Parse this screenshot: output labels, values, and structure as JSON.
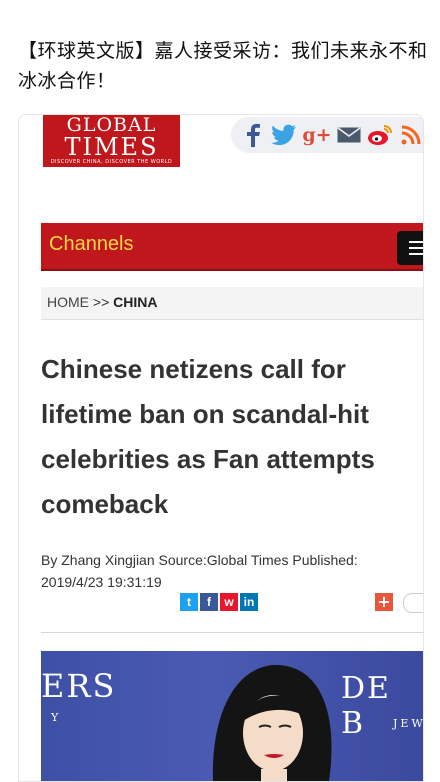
{
  "caption": "【环球英文版】嘉人接受采访：我们未来永不和冰冰合作！",
  "logo": {
    "line1": "GLOBAL",
    "line2": "TIMES",
    "tagline": "DISCOVER CHINA, DISCOVER THE WORLD"
  },
  "social_icons": [
    "facebook-icon",
    "twitter-icon",
    "google-plus-icon",
    "mail-icon",
    "weibo-icon",
    "rss-icon"
  ],
  "nav_icons": [
    "epaper-icon",
    "mobile-icon",
    "apps-icon",
    "location-icon",
    "target-icon"
  ],
  "channels": {
    "label": "Channels"
  },
  "breadcrumb": {
    "home": "HOME",
    "separator": ">>",
    "current": "CHINA"
  },
  "article": {
    "headline": "Chinese netizens call for lifetime ban on scandal-hit celebrities as Fan attempts comeback",
    "byline": "By Zhang Xingjian Source:Global Times Published: 2019/4/23 19:31:19"
  },
  "share_buttons": [
    {
      "name": "twitter",
      "glyph": "t",
      "color": "#1da1f2"
    },
    {
      "name": "facebook",
      "glyph": "f",
      "color": "#3b5998"
    },
    {
      "name": "weibo",
      "glyph": "w",
      "color": "#e6162d"
    },
    {
      "name": "linkedin",
      "glyph": "in",
      "color": "#0077b5"
    }
  ],
  "photo": {
    "text_left": "ERS",
    "text_left_small": "Y",
    "text_right": "DE B",
    "text_right_small": "JEW"
  },
  "colors": {
    "brand_red": "#c0171c",
    "channels_text": "#f2d64b",
    "photo_blue": "#4a5ab3"
  }
}
